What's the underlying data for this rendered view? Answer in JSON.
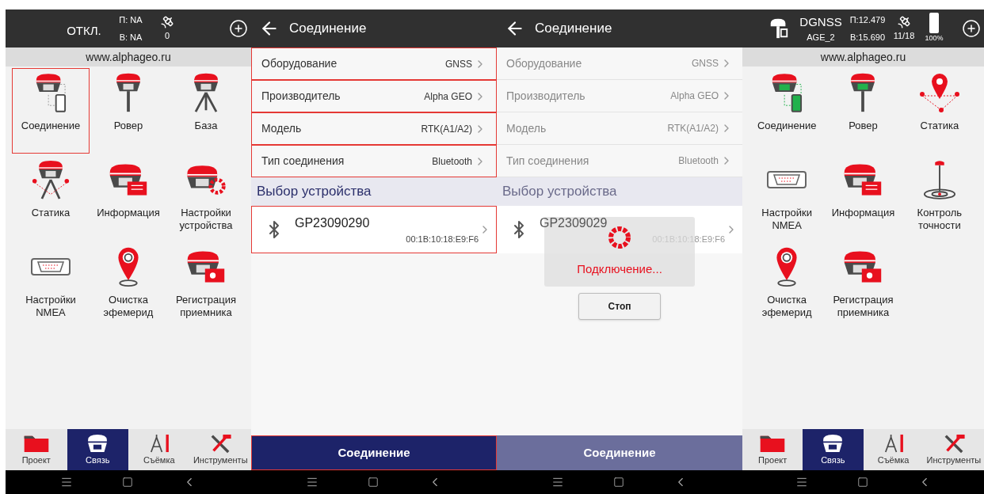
{
  "screens": [
    {
      "kind": "menu",
      "connected": false,
      "status": {
        "mode": "ОТКЛ.",
        "p": "П: NA",
        "b": "В: NA",
        "sats": "0"
      },
      "url": "www.alphageo.ru",
      "tiles": [
        {
          "label": "Соединение",
          "kind": "link",
          "highlighted": true
        },
        {
          "label": "Ровер",
          "kind": "rover",
          "highlighted": false
        },
        {
          "label": "База",
          "kind": "base",
          "highlighted": false
        },
        {
          "label": "Статика",
          "kind": "static",
          "highlighted": false
        },
        {
          "label": "Информация",
          "kind": "info",
          "highlighted": false
        },
        {
          "label": "Настройки устройства",
          "kind": "settings",
          "highlighted": false
        },
        {
          "label": "Настройки NMEA",
          "kind": "nmea",
          "highlighted": false
        },
        {
          "label": "Очистка эфемерид",
          "kind": "pin",
          "highlighted": false
        },
        {
          "label": "Регистрация приемника",
          "kind": "register",
          "highlighted": false
        }
      ],
      "nav": [
        {
          "label": "Проект",
          "kind": "folder",
          "selected": false
        },
        {
          "label": "Связь",
          "kind": "receiver",
          "selected": true
        },
        {
          "label": "Съёмка",
          "kind": "compass",
          "selected": false
        },
        {
          "label": "Инструменты",
          "kind": "tools",
          "selected": false
        }
      ]
    },
    {
      "kind": "connection",
      "dimmed": false,
      "title": "Соединение",
      "settings": [
        {
          "label": "Оборудование",
          "value": "GNSS",
          "highlighted": true
        },
        {
          "label": "Производитель",
          "value": "Alpha GEO",
          "highlighted": true
        },
        {
          "label": "Модель",
          "value": "RTK(A1/A2)",
          "highlighted": true
        },
        {
          "label": "Тип соединения",
          "value": "Bluetooth",
          "highlighted": true
        }
      ],
      "section": "Выбор устройства",
      "device": {
        "name": "GP23090290",
        "mac": "00:1B:10:18:E9:F6",
        "highlighted": true
      },
      "button": {
        "label": "Соединение",
        "highlighted": true
      }
    },
    {
      "kind": "connection",
      "dimmed": true,
      "title": "Соединение",
      "settings": [
        {
          "label": "Оборудование",
          "value": "GNSS",
          "highlighted": false
        },
        {
          "label": "Производитель",
          "value": "Alpha GEO",
          "highlighted": false
        },
        {
          "label": "Модель",
          "value": "RTK(A1/A2)",
          "highlighted": false
        },
        {
          "label": "Тип соединения",
          "value": "Bluetooth",
          "highlighted": false
        }
      ],
      "section": "Выбор устройства",
      "device": {
        "name": "GP2309029",
        "mac": "00:1B:10:18:E9:F6",
        "highlighted": false
      },
      "dialog": {
        "message": "Подключение...",
        "stop": "Стоп"
      },
      "button": {
        "label": "Соединение",
        "highlighted": false
      }
    },
    {
      "kind": "menu",
      "connected": true,
      "status": {
        "mode": "DGNSS",
        "age": "AGE_2",
        "p": "П:12.479",
        "b": "В:15.690",
        "sats": "11/18",
        "battery": "100%"
      },
      "url": "www.alphageo.ru",
      "tiles": [
        {
          "label": "Соединение",
          "kind": "link",
          "highlighted": false
        },
        {
          "label": "Ровер",
          "kind": "rover",
          "highlighted": false
        },
        {
          "label": "Статика",
          "kind": "static-pin",
          "highlighted": false
        },
        {
          "label": "Настройки NMEA",
          "kind": "nmea",
          "highlighted": false
        },
        {
          "label": "Информация",
          "kind": "info",
          "highlighted": false
        },
        {
          "label": "Контроль точности",
          "kind": "accuracy",
          "highlighted": false
        },
        {
          "label": "Очистка эфемерид",
          "kind": "pin",
          "highlighted": false
        },
        {
          "label": "Регистрация приемника",
          "kind": "register",
          "highlighted": false
        }
      ],
      "nav": [
        {
          "label": "Проект",
          "kind": "folder",
          "selected": false
        },
        {
          "label": "Связь",
          "kind": "receiver",
          "selected": true
        },
        {
          "label": "Съёмка",
          "kind": "compass",
          "selected": false
        },
        {
          "label": "Инструменты",
          "kind": "tools",
          "selected": false
        }
      ]
    }
  ]
}
